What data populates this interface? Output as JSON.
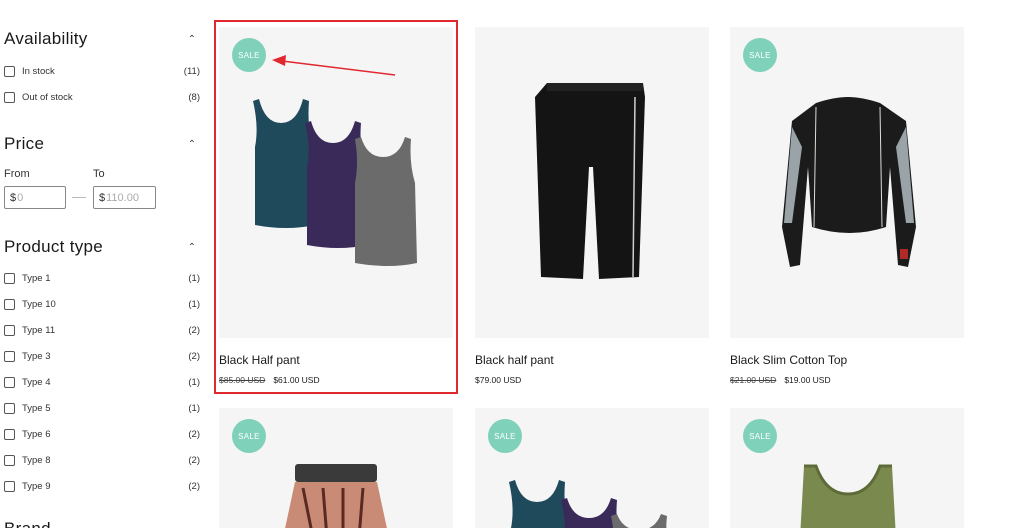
{
  "filters": {
    "availability": {
      "title": "Availability",
      "options": [
        {
          "label": "In stock",
          "count": "(11)"
        },
        {
          "label": "Out of stock",
          "count": "(8)"
        }
      ]
    },
    "price": {
      "title": "Price",
      "from_label": "From",
      "to_label": "To",
      "currency": "$",
      "from_placeholder": "0",
      "to_placeholder": "110.00"
    },
    "product_type": {
      "title": "Product type",
      "options": [
        {
          "label": "Type 1",
          "count": "(1)"
        },
        {
          "label": "Type 10",
          "count": "(1)"
        },
        {
          "label": "Type 11",
          "count": "(2)"
        },
        {
          "label": "Type 3",
          "count": "(2)"
        },
        {
          "label": "Type 4",
          "count": "(1)"
        },
        {
          "label": "Type 5",
          "count": "(1)"
        },
        {
          "label": "Type 6",
          "count": "(2)"
        },
        {
          "label": "Type 8",
          "count": "(2)"
        },
        {
          "label": "Type 9",
          "count": "(2)"
        }
      ]
    },
    "next_heading_partial": "Brand"
  },
  "badge_label": "SALE",
  "products": [
    {
      "name": "Black Half pant",
      "old_price": "$85.00 USD",
      "price": "$61.00 USD",
      "sale": true,
      "image": "tank-tops-three"
    },
    {
      "name": "Black half pant",
      "old_price": "",
      "price": "$79.00 USD",
      "sale": false,
      "image": "black-capri-pant"
    },
    {
      "name": "Black Slim Cotton Top",
      "old_price": "$21.00 USD",
      "price": "$19.00 USD",
      "sale": true,
      "image": "compression-top"
    },
    {
      "name": "",
      "old_price": "",
      "price": "",
      "sale": true,
      "image": "patterned-skirt"
    },
    {
      "name": "",
      "old_price": "",
      "price": "",
      "sale": true,
      "image": "tank-tops-three"
    },
    {
      "name": "",
      "old_price": "",
      "price": "",
      "sale": true,
      "image": "sports-bra"
    }
  ],
  "colors": {
    "sale_badge": "#7fd1b9",
    "highlight": "#e0282e",
    "card_bg": "#f5f5f5"
  }
}
